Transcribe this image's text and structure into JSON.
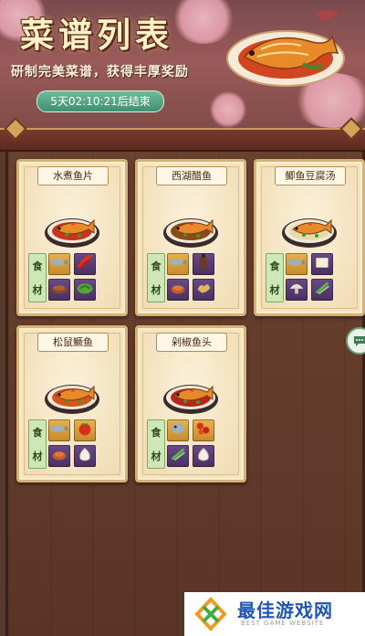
{
  "header": {
    "title": "菜谱列表",
    "subtitle": "研制完美菜谱，获得丰厚奖励",
    "timer": "5天02:10:21后结束"
  },
  "ingredient_label": [
    "食",
    "材"
  ],
  "recipes": [
    {
      "name": "水煮鱼片",
      "soup_color": "#c9341f",
      "ingredients": [
        {
          "icon": "fish-icon",
          "tile": "gold"
        },
        {
          "icon": "chili-icon",
          "tile": "purple"
        },
        {
          "icon": "bean-paste-icon",
          "tile": "purple"
        },
        {
          "icon": "vegetable-icon",
          "tile": "purple"
        }
      ]
    },
    {
      "name": "西湖醋鱼",
      "soup_color": "#8a4a1a",
      "ingredients": [
        {
          "icon": "fish-icon",
          "tile": "gold"
        },
        {
          "icon": "vinegar-icon",
          "tile": "purple"
        },
        {
          "icon": "sauce-icon",
          "tile": "purple"
        },
        {
          "icon": "ginger-icon",
          "tile": "purple"
        }
      ]
    },
    {
      "name": "鲫鱼豆腐汤",
      "soup_color": "#e8d9a8",
      "ingredients": [
        {
          "icon": "fish-icon",
          "tile": "gold"
        },
        {
          "icon": "tofu-icon",
          "tile": "purple"
        },
        {
          "icon": "mushroom-icon",
          "tile": "purple"
        },
        {
          "icon": "scallion-icon",
          "tile": "purple"
        }
      ]
    },
    {
      "name": "松鼠鳜鱼",
      "soup_color": "#d8541c",
      "ingredients": [
        {
          "icon": "fish-icon",
          "tile": "gold"
        },
        {
          "icon": "tomato-sauce-icon",
          "tile": "gold"
        },
        {
          "icon": "sauce-icon",
          "tile": "purple"
        },
        {
          "icon": "garlic-icon",
          "tile": "purple"
        }
      ]
    },
    {
      "name": "剁椒鱼头",
      "soup_color": "#b8241c",
      "ingredients": [
        {
          "icon": "fish-head-icon",
          "tile": "gold"
        },
        {
          "icon": "chopped-chili-icon",
          "tile": "gold"
        },
        {
          "icon": "scallion-icon",
          "tile": "purple"
        },
        {
          "icon": "garlic-icon",
          "tile": "purple"
        }
      ]
    }
  ],
  "watermark": {
    "title": "最佳游戏网",
    "subtitle": "BEST GAME WEBSITE"
  }
}
